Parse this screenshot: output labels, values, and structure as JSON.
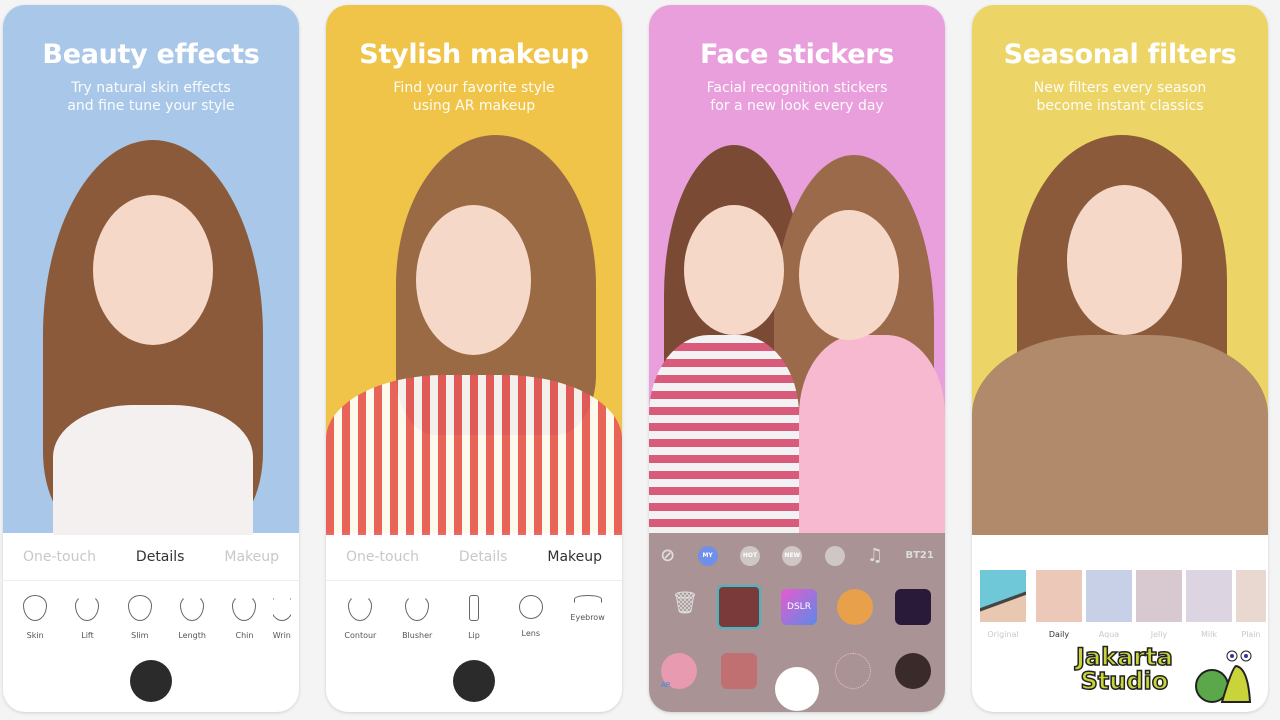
{
  "panels": [
    {
      "title": "Beauty effects",
      "subtitle_1": "Try natural skin effects",
      "subtitle_2": "and fine tune your style",
      "bg": "#a9c7e8",
      "tabs": [
        "One-touch",
        "Details",
        "Makeup"
      ],
      "active_tab": 1,
      "tools": [
        "Skin",
        "Lift",
        "Slim",
        "Length",
        "Chin",
        "Wrin"
      ]
    },
    {
      "title": "Stylish makeup",
      "subtitle_1": "Find your favorite style",
      "subtitle_2": "using AR makeup",
      "bg": "#efc449",
      "tabs": [
        "One-touch",
        "Details",
        "Makeup"
      ],
      "active_tab": 2,
      "tools": [
        "Contour",
        "Blusher",
        "Lip",
        "Lens",
        "Eyebrow"
      ]
    },
    {
      "title": "Face stickers",
      "subtitle_1": "Facial recognition stickers",
      "subtitle_2": "for a new look every day",
      "bg": "#e99fdc",
      "categories": [
        "MY",
        "HOT",
        "NEW",
        "BT21"
      ],
      "sticker_labels": [
        "DSLR",
        "AR"
      ]
    },
    {
      "title": "Seasonal filters",
      "subtitle_1": "New filters every season",
      "subtitle_2": "become instant classics",
      "bg": "#ecd566",
      "filters": [
        "Original",
        "Daily",
        "Aqua",
        "Jelly",
        "Milk",
        "Plain"
      ],
      "active_filter": 1
    }
  ],
  "watermark": {
    "line1": "Jakarta",
    "line2": "Studio"
  }
}
